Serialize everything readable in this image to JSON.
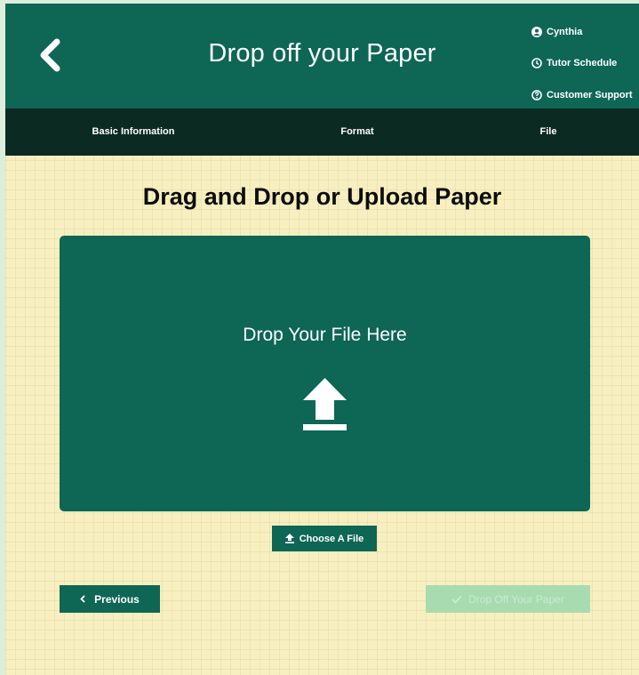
{
  "header": {
    "title": "Drop off your Paper",
    "back_icon": "chevron-left-icon",
    "user_links": [
      {
        "label": "Cynthia",
        "icon": "user-circle-icon"
      },
      {
        "label": "Tutor Schedule",
        "icon": "clock-icon"
      },
      {
        "label": "Customer Support",
        "icon": "question-circle-icon"
      }
    ]
  },
  "steps": [
    {
      "label": "Basic Information"
    },
    {
      "label": "Format"
    },
    {
      "label": "File"
    }
  ],
  "main": {
    "section_title": "Drag and Drop or Upload Paper",
    "dropzone": {
      "label": "Drop Your File Here",
      "icon": "upload-icon"
    },
    "choose_file_label": "Choose A File",
    "previous_label": "Previous",
    "drop_off_label": "Drop Off Your Paper",
    "drop_off_disabled": true
  },
  "colors": {
    "primary": "#0e6655",
    "steps_bar": "#0b2a22",
    "background": "#f7efbf",
    "disabled_button": "#a8dcb0"
  }
}
